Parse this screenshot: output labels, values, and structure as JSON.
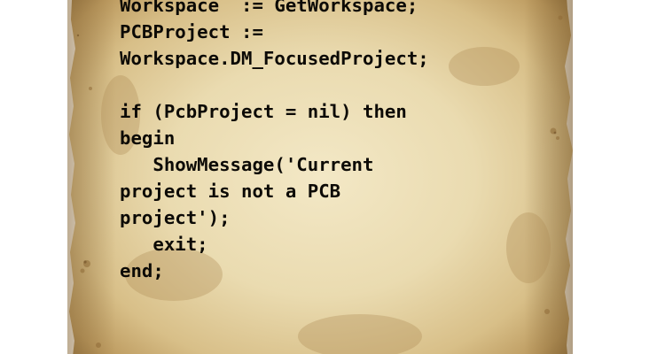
{
  "document": {
    "code_lines": [
      "Workspace  := GetWorkspace;",
      "PCBProject :=",
      "Workspace.DM_FocusedProject;",
      "",
      "if (PcbProject = nil) then",
      "begin",
      "   ShowMessage('Current",
      "project is not a PCB",
      "project');",
      "   exit;",
      "end;"
    ]
  },
  "colors": {
    "text": "#0c0a06",
    "paper_center": "#efe3bf",
    "paper_edge": "#a88550",
    "background": "#ffffff"
  }
}
